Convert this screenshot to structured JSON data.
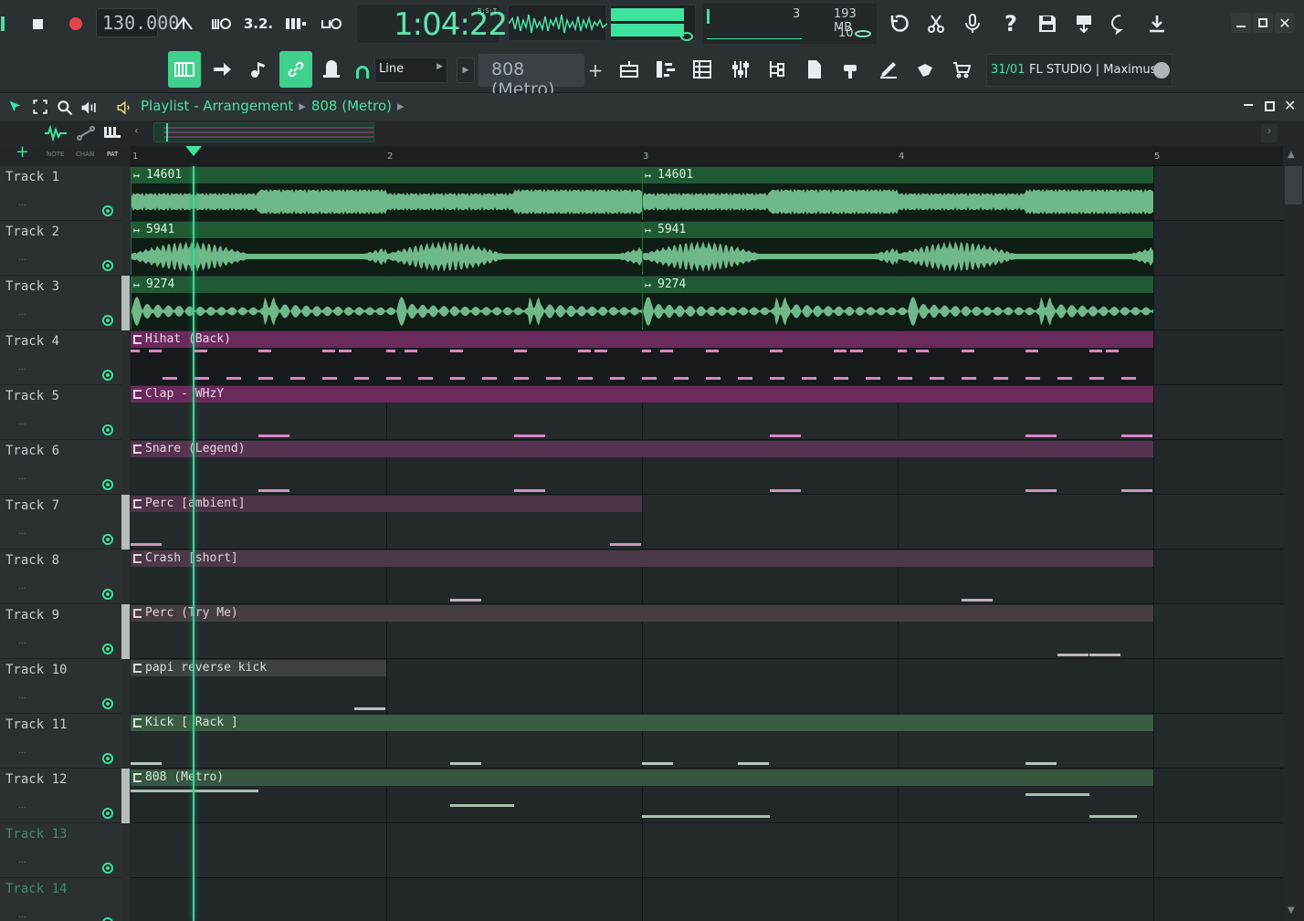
{
  "transport": {
    "tempo": "130.000",
    "time": "1:04:22",
    "time_unit": "B:S:T",
    "cpu_voices": "3",
    "memory": "193 MB",
    "polyphony": "10"
  },
  "toolbar": {
    "snap_mode": "Line",
    "pattern_name": "808 (Metro)",
    "hint_counter": "31/01",
    "hint_text": "FL STUDIO | Maximus"
  },
  "window": {
    "crumb1": "Playlist - Arrangement",
    "crumb2": "808 (Metro)",
    "tab_note": "NOTE",
    "tab_chan": "CHAN",
    "tab_pat": "PAT"
  },
  "ruler": [
    "1",
    "2",
    "3",
    "4",
    "5"
  ],
  "tracks": [
    {
      "name": "Track 1"
    },
    {
      "name": "Track 2"
    },
    {
      "name": "Track 3"
    },
    {
      "name": "Track 4"
    },
    {
      "name": "Track 5"
    },
    {
      "name": "Track 6"
    },
    {
      "name": "Track 7"
    },
    {
      "name": "Track 8"
    },
    {
      "name": "Track 9"
    },
    {
      "name": "Track 10"
    },
    {
      "name": "Track 11"
    },
    {
      "name": "Track 12"
    },
    {
      "name": "Track 13"
    },
    {
      "name": "Track 14"
    }
  ],
  "clips": {
    "a1": "14601",
    "a2": "14601",
    "b1": "5941",
    "b2": "5941",
    "c1": "9274",
    "c2": "9274",
    "hihat": "Hihat (Back)",
    "clap": "Clap - WHzY",
    "snare": "Snare (Legend)",
    "perc_ambient": "Perc [ambient]",
    "crash": "Crash [short]",
    "perc_tryme": "Perc (Try Me)",
    "papi": "papi reverse kick",
    "kick": "Kick [ Rack ]",
    "metro808": "808 (Metro)"
  },
  "colors": {
    "accent": "#3fe3a0",
    "audio_clip": "#1f5a34",
    "hihat_clip": "#6b2a5c",
    "snare_clip": "#56344f",
    "kick_clip": "#3c5b44"
  }
}
